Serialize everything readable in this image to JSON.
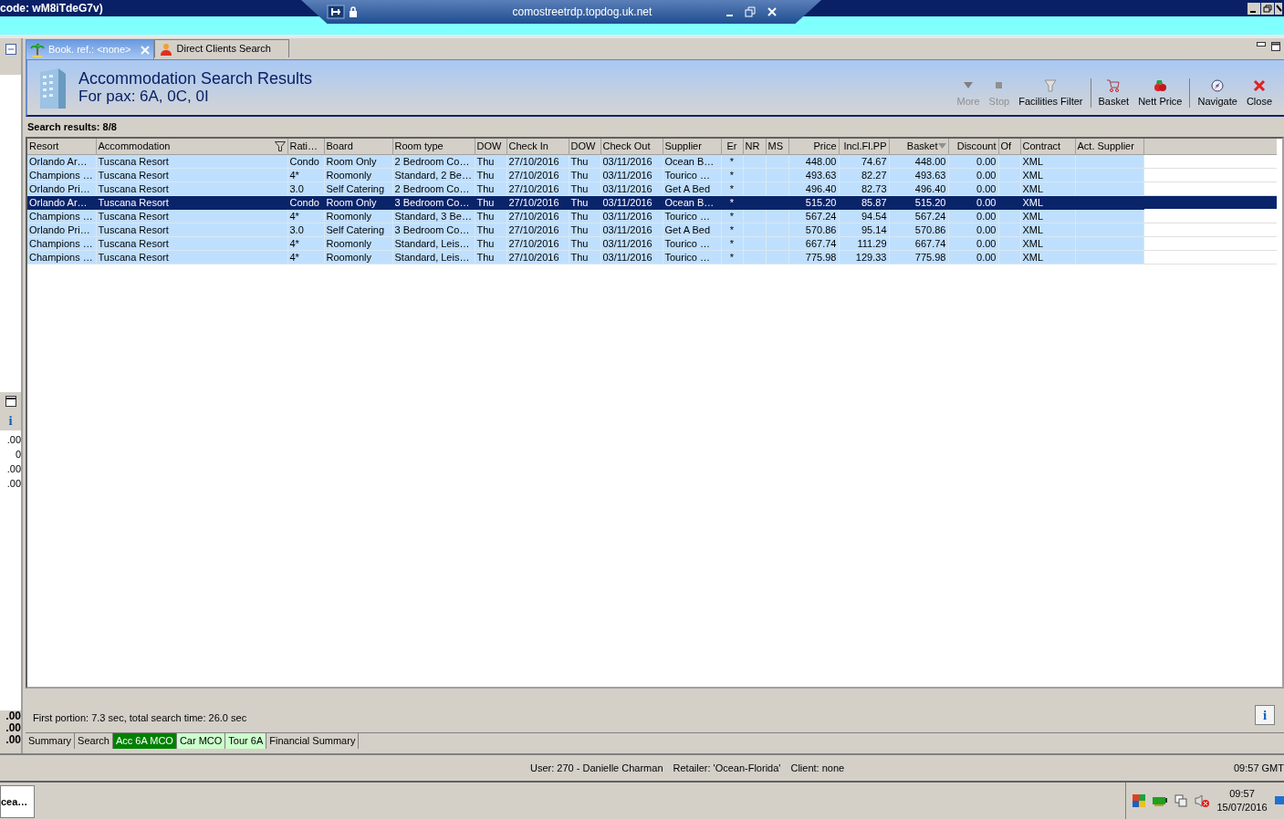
{
  "title_bar": {
    "title": "code: wM8iTdeG7v)"
  },
  "remote_bar": {
    "host": "comostreetrdp.topdog.uk.net"
  },
  "side_panel": {
    "info_label": "i",
    "values": [
      ".00",
      "0",
      ".00",
      ".00"
    ],
    "totals": [
      ".00",
      ".00",
      ".00"
    ]
  },
  "tabs": [
    {
      "label": "Book. ref.: <none>",
      "selected": true
    },
    {
      "label": "Direct Clients Search",
      "selected": false
    }
  ],
  "header": {
    "title": "Accommodation Search Results",
    "subtitle": "For pax: 6A, 0C, 0I"
  },
  "toolbar": [
    {
      "kind": "more",
      "label": "More",
      "disabled": true,
      "separator_before": false
    },
    {
      "kind": "stop",
      "label": "Stop",
      "disabled": true,
      "separator_before": false
    },
    {
      "kind": "filter",
      "label": "Facilities Filter",
      "disabled": false,
      "separator_before": false
    },
    {
      "kind": "basket",
      "label": "Basket",
      "disabled": false,
      "separator_before": true
    },
    {
      "kind": "price",
      "label": "Nett Price",
      "disabled": false,
      "separator_before": false
    },
    {
      "kind": "navigate",
      "label": "Navigate",
      "disabled": false,
      "separator_before": true
    },
    {
      "kind": "close",
      "label": "Close",
      "disabled": false,
      "separator_before": false
    }
  ],
  "results_count": "Search results: 8/8",
  "table": {
    "columns": [
      {
        "label": "Resort",
        "filtered": false,
        "sorted": false
      },
      {
        "label": "Accommodation",
        "filtered": true,
        "sorted": false
      },
      {
        "label": "Rati…",
        "filtered": false,
        "sorted": false
      },
      {
        "label": "Board",
        "filtered": false,
        "sorted": false
      },
      {
        "label": "Room type",
        "filtered": false,
        "sorted": false
      },
      {
        "label": "DOW",
        "filtered": false,
        "sorted": false
      },
      {
        "label": "Check In",
        "filtered": false,
        "sorted": false
      },
      {
        "label": "DOW",
        "filtered": false,
        "sorted": false
      },
      {
        "label": "Check Out",
        "filtered": false,
        "sorted": false
      },
      {
        "label": "Supplier",
        "filtered": false,
        "sorted": false
      },
      {
        "label": "Er",
        "filtered": false,
        "sorted": false
      },
      {
        "label": "NR",
        "filtered": false,
        "sorted": false
      },
      {
        "label": "MS",
        "filtered": false,
        "sorted": false
      },
      {
        "label": "Price",
        "filtered": false,
        "sorted": false
      },
      {
        "label": "Incl.Fl.PP",
        "filtered": false,
        "sorted": false
      },
      {
        "label": "Basket",
        "filtered": false,
        "sorted": true
      },
      {
        "label": "Discount",
        "filtered": false,
        "sorted": false
      },
      {
        "label": "Of",
        "filtered": false,
        "sorted": false
      },
      {
        "label": "Contract",
        "filtered": false,
        "sorted": false
      },
      {
        "label": "Act. Supplier",
        "filtered": false,
        "sorted": false
      }
    ],
    "rows": [
      {
        "selected": false,
        "cells": [
          "Orlando Ar…",
          "Tuscana Resort",
          "Condo",
          "Room Only",
          "2 Bedroom Co…",
          "Thu",
          "27/10/2016",
          "Thu",
          "03/11/2016",
          "Ocean B…",
          "*",
          "",
          "",
          "448.00",
          "74.67",
          "448.00",
          "0.00",
          "",
          "XML",
          ""
        ]
      },
      {
        "selected": false,
        "cells": [
          "Champions …",
          "Tuscana Resort",
          "4*",
          "Roomonly",
          "Standard, 2 Be…",
          "Thu",
          "27/10/2016",
          "Thu",
          "03/11/2016",
          "Tourico …",
          "*",
          "",
          "",
          "493.63",
          "82.27",
          "493.63",
          "0.00",
          "",
          "XML",
          ""
        ]
      },
      {
        "selected": false,
        "cells": [
          "Orlando Pri…",
          "Tuscana Resort",
          "3.0",
          "Self Catering",
          "2 Bedroom Co…",
          "Thu",
          "27/10/2016",
          "Thu",
          "03/11/2016",
          "Get A Bed",
          "*",
          "",
          "",
          "496.40",
          "82.73",
          "496.40",
          "0.00",
          "",
          "XML",
          ""
        ]
      },
      {
        "selected": true,
        "cells": [
          "Orlando Ar…",
          "Tuscana Resort",
          "Condo",
          "Room Only",
          "3 Bedroom Co…",
          "Thu",
          "27/10/2016",
          "Thu",
          "03/11/2016",
          "Ocean B…",
          "*",
          "",
          "",
          "515.20",
          "85.87",
          "515.20",
          "0.00",
          "",
          "XML",
          ""
        ]
      },
      {
        "selected": false,
        "cells": [
          "Champions …",
          "Tuscana Resort",
          "4*",
          "Roomonly",
          "Standard, 3 Be…",
          "Thu",
          "27/10/2016",
          "Thu",
          "03/11/2016",
          "Tourico …",
          "*",
          "",
          "",
          "567.24",
          "94.54",
          "567.24",
          "0.00",
          "",
          "XML",
          ""
        ]
      },
      {
        "selected": false,
        "cells": [
          "Orlando Pri…",
          "Tuscana Resort",
          "3.0",
          "Self Catering",
          "3 Bedroom Co…",
          "Thu",
          "27/10/2016",
          "Thu",
          "03/11/2016",
          "Get A Bed",
          "*",
          "",
          "",
          "570.86",
          "95.14",
          "570.86",
          "0.00",
          "",
          "XML",
          ""
        ]
      },
      {
        "selected": false,
        "cells": [
          "Champions …",
          "Tuscana Resort",
          "4*",
          "Roomonly",
          "Standard, Leis…",
          "Thu",
          "27/10/2016",
          "Thu",
          "03/11/2016",
          "Tourico …",
          "*",
          "",
          "",
          "667.74",
          "111.29",
          "667.74",
          "0.00",
          "",
          "XML",
          ""
        ]
      },
      {
        "selected": false,
        "cells": [
          "Champions …",
          "Tuscana Resort",
          "4*",
          "Roomonly",
          "Standard, Leis…",
          "Thu",
          "27/10/2016",
          "Thu",
          "03/11/2016",
          "Tourico …",
          "*",
          "",
          "",
          "775.98",
          "129.33",
          "775.98",
          "0.00",
          "",
          "XML",
          ""
        ]
      }
    ]
  },
  "timing": "First portion: 7.3 sec, total search time: 26.0 sec",
  "info_button": "i",
  "bottom_tabs": [
    {
      "label": "Summary",
      "selected": false,
      "color": "#d4d0c8"
    },
    {
      "label": "Search",
      "selected": false,
      "color": "#d4d0c8"
    },
    {
      "label": "Acc 6A MCO",
      "selected": true,
      "color": "#008000"
    },
    {
      "label": "Car MCO",
      "selected": false,
      "color": "#ccffcc"
    },
    {
      "label": "Tour 6A",
      "selected": false,
      "color": "#ccffcc"
    },
    {
      "label": "Financial Summary",
      "selected": false,
      "color": "#d4d0c8"
    }
  ],
  "status_bar": {
    "user": "User: 270 - Danielle Charman",
    "retailer": "Retailer: 'Ocean-Florida'",
    "client": "Client: none",
    "time": "09:57 GMT"
  },
  "taskbar": {
    "app": "cea…",
    "time": "09:57",
    "date": "15/07/2016"
  }
}
